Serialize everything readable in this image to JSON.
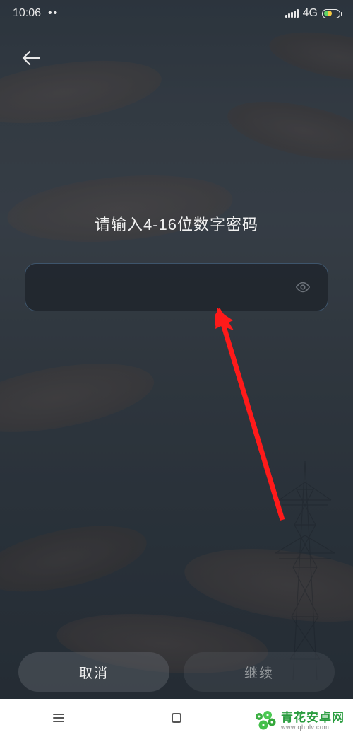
{
  "statusBar": {
    "time": "10:06",
    "dots": "••",
    "network": "4G"
  },
  "prompt": "请输入4-16位数字密码",
  "input": {
    "value": "",
    "placeholder": ""
  },
  "buttons": {
    "cancel": "取消",
    "continue": "继续"
  },
  "watermark": {
    "title": "青花安卓网",
    "url": "www.qhhlv.com"
  }
}
